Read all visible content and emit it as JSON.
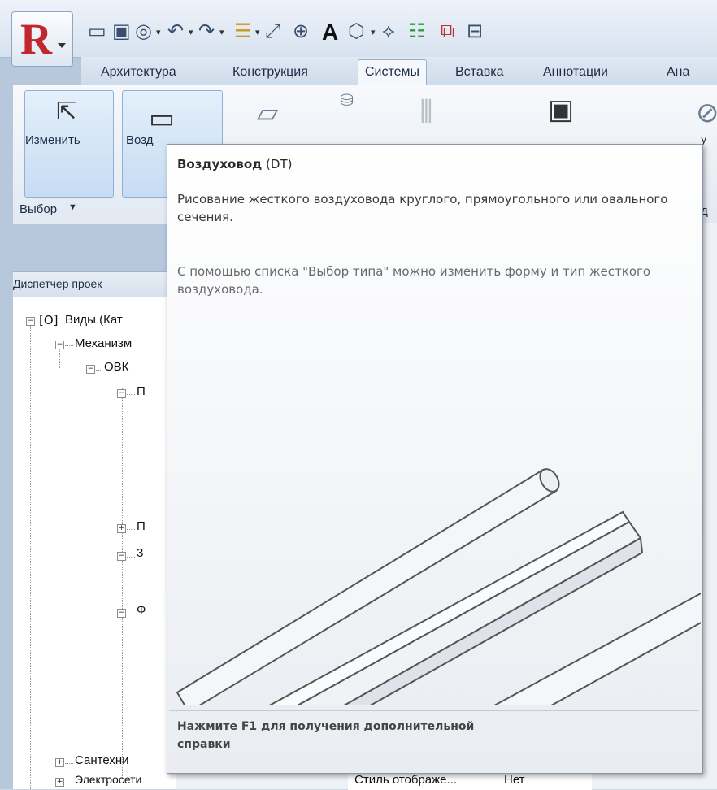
{
  "quick_access": {
    "app_letter": "R",
    "icons": [
      "open-icon",
      "save-icon",
      "sync-icon",
      "undo-icon",
      "redo-icon",
      "align-icon",
      "measure-icon",
      "tag-icon",
      "text-icon",
      "3d-view-icon",
      "section-icon",
      "thin-lines-icon",
      "close-hidden-icon",
      "switch-windows-icon"
    ],
    "text_tool_label": "A"
  },
  "tabs": [
    {
      "label": "Архитектура"
    },
    {
      "label": "Конструкция"
    },
    {
      "label": "Системы"
    },
    {
      "label": "Вставка"
    },
    {
      "label": "Аннотации"
    },
    {
      "label": "Ана"
    }
  ],
  "active_tab": "Системы",
  "ribbon": {
    "modify_label": "Изменить",
    "duct_label": "Возд",
    "select_panel_label": "Выбор",
    "partial_label_1": "у",
    "partial_label_2": "д"
  },
  "project_browser": {
    "header": "Диспетчер проек",
    "items": [
      {
        "label": "Виды (Кат"
      },
      {
        "label": "Механизм"
      },
      {
        "label": "ОВК"
      },
      {
        "label": "П"
      },
      {
        "label": "П"
      },
      {
        "label": "3"
      },
      {
        "label": "Ф"
      },
      {
        "label": "Сантехни"
      },
      {
        "label": "Электросети"
      }
    ]
  },
  "properties": {
    "row_label": "Стиль отображе...",
    "row_value": "Нет"
  },
  "tooltip": {
    "title_bold": "Воздуховод",
    "title_shortcut": "(DT)",
    "description": "Рисование жесткого воздуховода круглого, прямоугольного или овального сечения.",
    "extended": "С помощью списка \"Выбор типа\" можно изменить форму и тип жесткого воздуховода.",
    "footer": "Нажмите F1 для получения дополнительной справки"
  },
  "colors": {
    "ribbon_bg": "#e2e9f2",
    "active_button": "#c6dcf2",
    "app_logo_red": "#c0282d",
    "tooltip_border": "#8a96a6"
  }
}
